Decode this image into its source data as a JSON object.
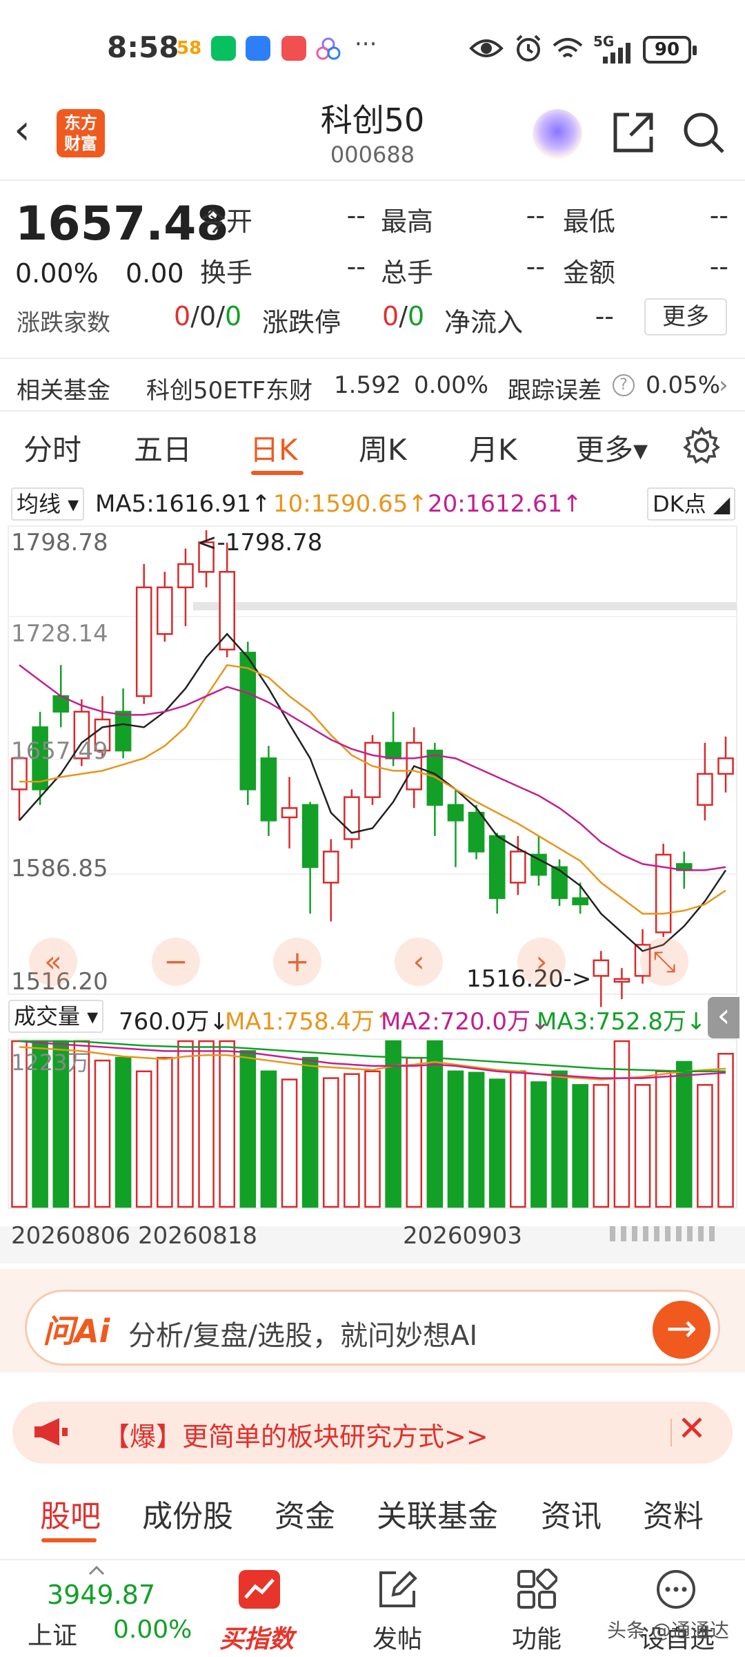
{
  "status_bar": {
    "time": "8:58",
    "app_icons": [
      {
        "name": "58-icon",
        "color": "#f6a000"
      },
      {
        "name": "wechat-icon",
        "color": "#07c160"
      },
      {
        "name": "lightbulb-icon",
        "color": "#2d7ff9"
      },
      {
        "name": "book-icon",
        "color": "#f05050"
      },
      {
        "name": "cloud-icon",
        "color": "#8a74ff"
      }
    ],
    "more_dots": "···",
    "network": "5G",
    "battery": "90"
  },
  "header": {
    "back_label": "‹",
    "logo_text_1": "东方",
    "logo_text_2": "财富",
    "title": "科创50",
    "code": "000688"
  },
  "quote": {
    "price": "1657.48",
    "change_pct": "0.00%",
    "change": "0.00",
    "fields": [
      {
        "label": "今开",
        "value": "--"
      },
      {
        "label": "最高",
        "value": "--"
      },
      {
        "label": "最低",
        "value": "--"
      },
      {
        "label": "换手",
        "value": "--"
      },
      {
        "label": "总手",
        "value": "--"
      },
      {
        "label": "金额",
        "value": "--"
      }
    ],
    "advance_label": "涨跌家数",
    "advance_up": "0",
    "advance_flat": "0",
    "advance_down": "0",
    "limit_label": "涨跌停",
    "limit_up": "0",
    "limit_down": "0",
    "netflow_label": "净流入",
    "netflow_value": "--",
    "more_button": "更多",
    "slash": "/"
  },
  "fund_row": {
    "label": "相关基金",
    "fund_name": "科创50ETF东财",
    "fund_price": "1.592",
    "fund_pct": "0.00%",
    "tracking_label": "跟踪误差",
    "tracking_value": "0.05%",
    "help_glyph": "?",
    "chevron": "›"
  },
  "period_tabs": [
    {
      "label": "分时",
      "active": false
    },
    {
      "label": "五日",
      "active": false
    },
    {
      "label": "日K",
      "active": true
    },
    {
      "label": "周K",
      "active": false
    },
    {
      "label": "月K",
      "active": false
    },
    {
      "label": "更多▾",
      "active": false
    }
  ],
  "ma_legend": {
    "selector": "均线 ▾",
    "ma5": "MA5:1616.91↑",
    "ma10": "10:1590.65↑",
    "ma20": "20:1612.61↑",
    "dk_button": "DK点 ◢",
    "colors": {
      "ma5": "#222222",
      "ma10": "#e8951a",
      "ma20": "#c21f8e"
    }
  },
  "price_axis": {
    "ticks": [
      "1798.78",
      "1728.14",
      "1657.49",
      "1586.85",
      "1516.20"
    ],
    "high_marker": "<-1798.78",
    "low_marker": "1516.20->"
  },
  "volume_legend": {
    "selector": "成交量 ▾",
    "vol": "760.0万↓",
    "ma1": "MA1:758.4万↑",
    "ma2": "MA2:720.0万↓",
    "ma3": "MA3:752.8万↓",
    "collapse": "‹",
    "scale_label": "1223万",
    "colors": {
      "ma1": "#e8951a",
      "ma2": "#c21f8e",
      "ma3": "#12a027"
    }
  },
  "date_axis": [
    "20260806",
    "20260818",
    "20260903"
  ],
  "zoom_controls": [
    "«",
    "−",
    "+",
    "‹",
    "›",
    "⤡"
  ],
  "chart_data": {
    "type": "candlestick",
    "ylim": [
      1516.2,
      1798.78
    ],
    "colors": {
      "up": "#d9292b",
      "down": "#12a027"
    },
    "candles": [
      {
        "o": 1640,
        "c": 1660,
        "h": 1665,
        "l": 1620
      },
      {
        "o": 1680,
        "c": 1640,
        "h": 1690,
        "l": 1630
      },
      {
        "o": 1700,
        "c": 1690,
        "h": 1720,
        "l": 1680
      },
      {
        "o": 1660,
        "c": 1690,
        "h": 1698,
        "l": 1655
      },
      {
        "o": 1665,
        "c": 1685,
        "h": 1700,
        "l": 1660
      },
      {
        "o": 1690,
        "c": 1665,
        "h": 1705,
        "l": 1660
      },
      {
        "o": 1700,
        "c": 1770,
        "h": 1785,
        "l": 1695
      },
      {
        "o": 1740,
        "c": 1770,
        "h": 1780,
        "l": 1735
      },
      {
        "o": 1770,
        "c": 1785,
        "h": 1795,
        "l": 1745
      },
      {
        "o": 1780,
        "c": 1799,
        "h": 1810,
        "l": 1770
      },
      {
        "o": 1730,
        "c": 1780,
        "h": 1798.78,
        "l": 1725
      },
      {
        "o": 1728,
        "c": 1640,
        "h": 1735,
        "l": 1630
      },
      {
        "o": 1660,
        "c": 1620,
        "h": 1668,
        "l": 1610
      },
      {
        "o": 1622,
        "c": 1628,
        "h": 1648,
        "l": 1602
      },
      {
        "o": 1630,
        "c": 1590,
        "h": 1632,
        "l": 1560
      },
      {
        "o": 1580,
        "c": 1600,
        "h": 1608,
        "l": 1555
      },
      {
        "o": 1608,
        "c": 1635,
        "h": 1640,
        "l": 1602
      },
      {
        "o": 1635,
        "c": 1670,
        "h": 1675,
        "l": 1630
      },
      {
        "o": 1670,
        "c": 1660,
        "h": 1690,
        "l": 1655
      },
      {
        "o": 1640,
        "c": 1670,
        "h": 1680,
        "l": 1628
      },
      {
        "o": 1665,
        "c": 1630,
        "h": 1670,
        "l": 1610
      },
      {
        "o": 1630,
        "c": 1620,
        "h": 1640,
        "l": 1590
      },
      {
        "o": 1625,
        "c": 1600,
        "h": 1630,
        "l": 1595
      },
      {
        "o": 1610,
        "c": 1570,
        "h": 1612,
        "l": 1560
      },
      {
        "o": 1580,
        "c": 1600,
        "h": 1610,
        "l": 1572
      },
      {
        "o": 1598,
        "c": 1585,
        "h": 1610,
        "l": 1578
      },
      {
        "o": 1590,
        "c": 1570,
        "h": 1595,
        "l": 1565
      },
      {
        "o": 1570,
        "c": 1566,
        "h": 1580,
        "l": 1560
      },
      {
        "o": 1520,
        "c": 1530,
        "h": 1536,
        "l": 1500
      },
      {
        "o": 1516.2,
        "c": 1518,
        "h": 1525,
        "l": 1505
      },
      {
        "o": 1520,
        "c": 1540,
        "h": 1550,
        "l": 1515
      },
      {
        "o": 1548,
        "c": 1598,
        "h": 1605,
        "l": 1545
      },
      {
        "o": 1592,
        "c": 1588,
        "h": 1600,
        "l": 1576
      },
      {
        "o": 1630,
        "c": 1650,
        "h": 1670,
        "l": 1620
      },
      {
        "o": 1650,
        "c": 1660,
        "h": 1674,
        "l": 1638
      }
    ],
    "ma5": [
      1620,
      1635,
      1650,
      1670,
      1680,
      1682,
      1680,
      1690,
      1705,
      1725,
      1740,
      1725,
      1705,
      1682,
      1660,
      1625,
      1612,
      1615,
      1632,
      1655,
      1650,
      1640,
      1628,
      1610,
      1602,
      1595,
      1588,
      1578,
      1560,
      1548,
      1536,
      1540,
      1552,
      1568,
      1588
    ],
    "ma10": [
      1645,
      1645,
      1648,
      1650,
      1652,
      1656,
      1660,
      1668,
      1680,
      1700,
      1720,
      1718,
      1712,
      1700,
      1690,
      1675,
      1662,
      1655,
      1652,
      1652,
      1648,
      1640,
      1632,
      1625,
      1618,
      1610,
      1602,
      1594,
      1580,
      1570,
      1560,
      1560,
      1562,
      1566,
      1575
    ],
    "ma20": [
      1720,
      1710,
      1700,
      1694,
      1690,
      1688,
      1688,
      1690,
      1694,
      1700,
      1706,
      1702,
      1696,
      1688,
      1680,
      1672,
      1666,
      1662,
      1660,
      1660,
      1662,
      1660,
      1654,
      1648,
      1642,
      1636,
      1628,
      1618,
      1606,
      1598,
      1592,
      1590,
      1588,
      1588,
      1590
    ],
    "volume": [
      1223,
      1223,
      1223,
      1223,
      1080,
      1100,
      1000,
      1100,
      1223,
      1223,
      1223,
      1150,
      1000,
      940,
      1100,
      950,
      980,
      1000,
      1223,
      1100,
      1223,
      1000,
      990,
      940,
      1000,
      920,
      1000,
      900,
      900,
      1223,
      900,
      1000,
      1070,
      900,
      1130
    ],
    "vol_ylim": [
      0,
      1223
    ],
    "vol_ma1": [
      1180,
      1170,
      1160,
      1150,
      1130,
      1110,
      1100,
      1090,
      1110,
      1120,
      1120,
      1100,
      1080,
      1060,
      1040,
      1030,
      1020,
      1010,
      1040,
      1050,
      1070,
      1050,
      1030,
      1010,
      1000,
      980,
      960,
      950,
      940,
      950,
      960,
      980,
      1000,
      1010,
      1020
    ],
    "vol_ma2": [
      1223,
      1210,
      1200,
      1190,
      1180,
      1170,
      1160,
      1150,
      1150,
      1150,
      1150,
      1140,
      1120,
      1100,
      1080,
      1060,
      1050,
      1040,
      1040,
      1040,
      1050,
      1040,
      1020,
      1000,
      990,
      980,
      970,
      960,
      950,
      950,
      950,
      960,
      970,
      980,
      990
    ],
    "vol_ma3": [
      1223,
      1223,
      1223,
      1220,
      1210,
      1200,
      1190,
      1185,
      1180,
      1180,
      1180,
      1170,
      1160,
      1150,
      1140,
      1130,
      1120,
      1110,
      1105,
      1100,
      1100,
      1090,
      1080,
      1070,
      1060,
      1050,
      1040,
      1030,
      1020,
      1015,
      1010,
      1005,
      1000,
      1000,
      1000
    ]
  },
  "ai_box": {
    "logo": "问Ai",
    "prompt": "分析/复盘/选股，就问妙想AI",
    "go": "→"
  },
  "banner": {
    "icon": "megaphone-icon",
    "text": "【爆】更简单的板块研究方式>>",
    "close": "✕"
  },
  "bottom_tabs": [
    {
      "label": "股吧",
      "active": true
    },
    {
      "label": "成份股",
      "active": false
    },
    {
      "label": "资金",
      "active": false
    },
    {
      "label": "关联基金",
      "active": false
    },
    {
      "label": "资讯",
      "active": false
    },
    {
      "label": "资料",
      "active": false
    }
  ],
  "bottom_bar": {
    "index_price": "3949.87",
    "index_name": "上证",
    "index_pct": "0.00%",
    "buy_label": "买指数",
    "post_label": "发帖",
    "func_label": "功能",
    "self_label": "设自选",
    "watermark": "头条 @通通达"
  }
}
